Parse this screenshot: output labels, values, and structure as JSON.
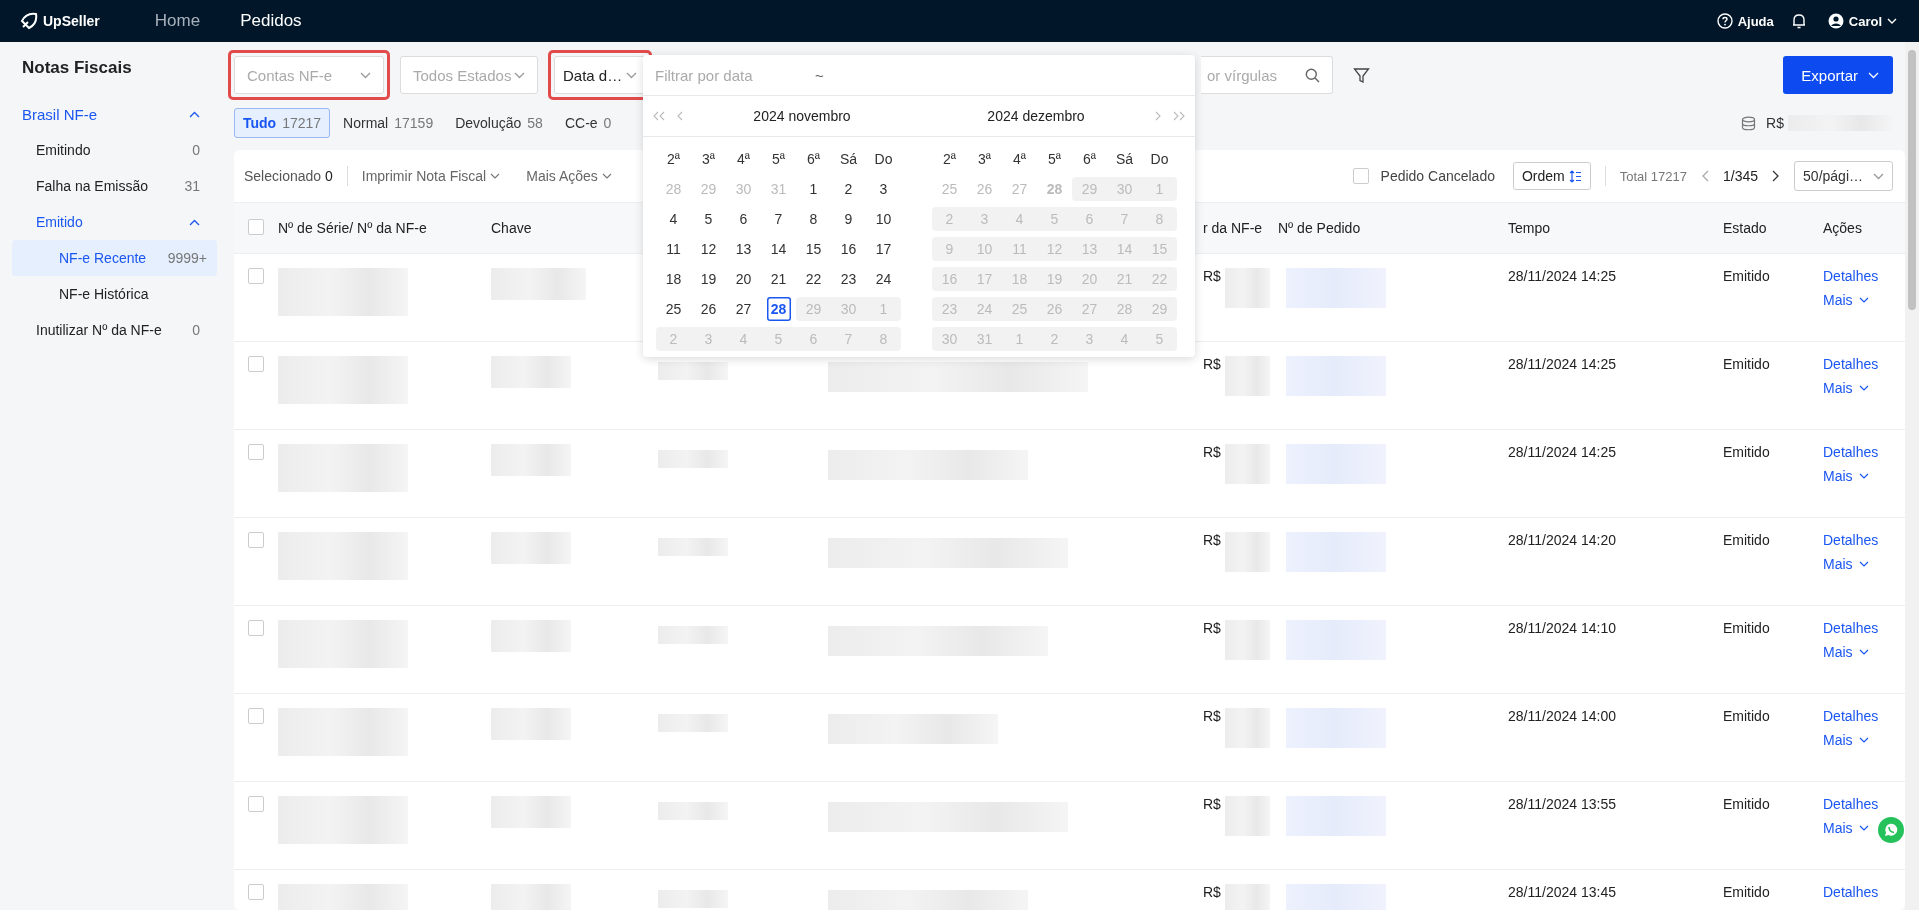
{
  "topbar": {
    "logo": "UpSeller",
    "nav": [
      {
        "label": "Home",
        "selected": false
      },
      {
        "label": "Pedidos",
        "selected": true
      }
    ],
    "help": "Ajuda",
    "user": "Carol"
  },
  "sidebar": {
    "title": "Notas Fiscais",
    "items": [
      {
        "label": "Brasil NF-e",
        "selected": false,
        "expanded": true,
        "children": [
          {
            "label": "Emitindo",
            "count": "0",
            "selected": false
          },
          {
            "label": "Falha na Emissão",
            "count": "31",
            "selected": false
          },
          {
            "label": "Emitido",
            "selected": false,
            "expanded": true,
            "children": [
              {
                "label": "NF-e Recente",
                "count": "9999+",
                "selected": true
              },
              {
                "label": "NF-e Histórica",
                "selected": false
              }
            ]
          },
          {
            "label": "Inutilizar Nº da NF-e",
            "count": "0",
            "selected": false
          }
        ]
      }
    ]
  },
  "filters": [
    {
      "kind": "select",
      "placeholder": "Contas NF-e",
      "highlighted": true
    },
    {
      "kind": "select",
      "placeholder": "Todos Estados",
      "highlighted": false
    },
    {
      "kind": "select",
      "value": "Data d…",
      "highlighted": true
    }
  ],
  "search": {
    "placeholder": "or vírgulas"
  },
  "export_button": "Exportar",
  "tabs": [
    {
      "label": "Tudo",
      "count": "17217",
      "selected": true
    },
    {
      "label": "Normal",
      "count": "17159",
      "selected": false
    },
    {
      "label": "Devolução",
      "count": "58",
      "selected": false
    },
    {
      "label": "CC-e",
      "count": "0",
      "selected": false
    }
  ],
  "total_amount": "R$",
  "toolbar": {
    "selected_label": "Selecionado",
    "selected_count": "0",
    "actions": [
      "Imprimir Nota Fiscal",
      "Mais Ações"
    ],
    "cancelled_filter": {
      "label": "Pedido Cancelado",
      "checked": false
    },
    "sort_button": "Ordem",
    "total": "Total 17217",
    "page": "1/345",
    "page_size": "50/pági…"
  },
  "table": {
    "all_checked": false,
    "columns": [
      "Nº de Série/ Nº da NF-e",
      "Chave",
      "",
      "",
      "r da NF-e",
      "Nº de Pedido",
      "Tempo",
      "Estado",
      "Ações"
    ],
    "rows": [
      {
        "checked": false,
        "amount": "R$",
        "time": "28/11/2024 14:25",
        "status": "Emitido",
        "details": "Detalhes",
        "more": "Mais"
      },
      {
        "checked": false,
        "amount": "R$",
        "time": "28/11/2024 14:25",
        "status": "Emitido",
        "details": "Detalhes",
        "more": "Mais"
      },
      {
        "checked": false,
        "amount": "R$",
        "time": "28/11/2024 14:25",
        "status": "Emitido",
        "details": "Detalhes",
        "more": "Mais"
      },
      {
        "checked": false,
        "amount": "R$",
        "time": "28/11/2024 14:20",
        "status": "Emitido",
        "details": "Detalhes",
        "more": "Mais"
      },
      {
        "checked": false,
        "amount": "R$",
        "time": "28/11/2024 14:10",
        "status": "Emitido",
        "details": "Detalhes",
        "more": "Mais"
      },
      {
        "checked": false,
        "amount": "R$",
        "time": "28/11/2024 14:00",
        "status": "Emitido",
        "details": "Detalhes",
        "more": "Mais"
      },
      {
        "checked": false,
        "amount": "R$",
        "time": "28/11/2024 13:55",
        "status": "Emitido",
        "details": "Detalhes",
        "more": "Mais"
      },
      {
        "checked": false,
        "amount": "R$",
        "time": "28/11/2024 13:45",
        "status": "Emitido",
        "details": "Detalhes"
      }
    ]
  },
  "date_picker": {
    "placeholder": "Filtrar por data",
    "separator": "~",
    "months": [
      {
        "title": "2024 novembro",
        "weekdays": [
          "2ª",
          "3ª",
          "4ª",
          "5ª",
          "6ª",
          "Sá",
          "Do"
        ],
        "weeks": [
          [
            {
              "d": "28",
              "kind": "outside"
            },
            {
              "d": "29",
              "kind": "outside"
            },
            {
              "d": "30",
              "kind": "outside"
            },
            {
              "d": "31",
              "kind": "outside"
            },
            {
              "d": "1",
              "kind": "normal"
            },
            {
              "d": "2",
              "kind": "normal"
            },
            {
              "d": "3",
              "kind": "normal"
            }
          ],
          [
            {
              "d": "4",
              "kind": "normal"
            },
            {
              "d": "5",
              "kind": "normal"
            },
            {
              "d": "6",
              "kind": "normal"
            },
            {
              "d": "7",
              "kind": "normal"
            },
            {
              "d": "8",
              "kind": "normal"
            },
            {
              "d": "9",
              "kind": "normal"
            },
            {
              "d": "10",
              "kind": "normal"
            }
          ],
          [
            {
              "d": "11",
              "kind": "normal"
            },
            {
              "d": "12",
              "kind": "normal"
            },
            {
              "d": "13",
              "kind": "normal"
            },
            {
              "d": "14",
              "kind": "normal"
            },
            {
              "d": "15",
              "kind": "normal"
            },
            {
              "d": "16",
              "kind": "normal"
            },
            {
              "d": "17",
              "kind": "normal"
            }
          ],
          [
            {
              "d": "18",
              "kind": "normal"
            },
            {
              "d": "19",
              "kind": "normal"
            },
            {
              "d": "20",
              "kind": "normal"
            },
            {
              "d": "21",
              "kind": "normal"
            },
            {
              "d": "22",
              "kind": "normal"
            },
            {
              "d": "23",
              "kind": "normal"
            },
            {
              "d": "24",
              "kind": "normal"
            }
          ],
          [
            {
              "d": "25",
              "kind": "normal"
            },
            {
              "d": "26",
              "kind": "normal"
            },
            {
              "d": "27",
              "kind": "normal"
            },
            {
              "d": "28",
              "kind": "today"
            },
            {
              "d": "29",
              "kind": "disabled"
            },
            {
              "d": "30",
              "kind": "disabled"
            },
            {
              "d": "1",
              "kind": "disabled"
            }
          ],
          [
            {
              "d": "2",
              "kind": "disabled"
            },
            {
              "d": "3",
              "kind": "disabled"
            },
            {
              "d": "4",
              "kind": "disabled"
            },
            {
              "d": "5",
              "kind": "disabled"
            },
            {
              "d": "6",
              "kind": "disabled"
            },
            {
              "d": "7",
              "kind": "disabled"
            },
            {
              "d": "8",
              "kind": "disabled"
            }
          ]
        ]
      },
      {
        "title": "2024 dezembro",
        "weekdays": [
          "2ª",
          "3ª",
          "4ª",
          "5ª",
          "6ª",
          "Sá",
          "Do"
        ],
        "weeks": [
          [
            {
              "d": "25",
              "kind": "outside"
            },
            {
              "d": "26",
              "kind": "outside"
            },
            {
              "d": "27",
              "kind": "outside"
            },
            {
              "d": "28",
              "kind": "outside-today"
            },
            {
              "d": "29",
              "kind": "disabled"
            },
            {
              "d": "30",
              "kind": "disabled"
            },
            {
              "d": "1",
              "kind": "disabled"
            }
          ],
          [
            {
              "d": "2",
              "kind": "disabled"
            },
            {
              "d": "3",
              "kind": "disabled"
            },
            {
              "d": "4",
              "kind": "disabled"
            },
            {
              "d": "5",
              "kind": "disabled"
            },
            {
              "d": "6",
              "kind": "disabled"
            },
            {
              "d": "7",
              "kind": "disabled"
            },
            {
              "d": "8",
              "kind": "disabled"
            }
          ],
          [
            {
              "d": "9",
              "kind": "disabled"
            },
            {
              "d": "10",
              "kind": "disabled"
            },
            {
              "d": "11",
              "kind": "disabled"
            },
            {
              "d": "12",
              "kind": "disabled"
            },
            {
              "d": "13",
              "kind": "disabled"
            },
            {
              "d": "14",
              "kind": "disabled"
            },
            {
              "d": "15",
              "kind": "disabled"
            }
          ],
          [
            {
              "d": "16",
              "kind": "disabled"
            },
            {
              "d": "17",
              "kind": "disabled"
            },
            {
              "d": "18",
              "kind": "disabled"
            },
            {
              "d": "19",
              "kind": "disabled"
            },
            {
              "d": "20",
              "kind": "disabled"
            },
            {
              "d": "21",
              "kind": "disabled"
            },
            {
              "d": "22",
              "kind": "disabled"
            }
          ],
          [
            {
              "d": "23",
              "kind": "disabled"
            },
            {
              "d": "24",
              "kind": "disabled"
            },
            {
              "d": "25",
              "kind": "disabled"
            },
            {
              "d": "26",
              "kind": "disabled"
            },
            {
              "d": "27",
              "kind": "disabled"
            },
            {
              "d": "28",
              "kind": "disabled"
            },
            {
              "d": "29",
              "kind": "disabled"
            }
          ],
          [
            {
              "d": "30",
              "kind": "disabled"
            },
            {
              "d": "31",
              "kind": "disabled"
            },
            {
              "d": "1",
              "kind": "disabled"
            },
            {
              "d": "2",
              "kind": "disabled"
            },
            {
              "d": "3",
              "kind": "disabled"
            },
            {
              "d": "4",
              "kind": "disabled"
            },
            {
              "d": "5",
              "kind": "disabled"
            }
          ]
        ]
      }
    ]
  }
}
